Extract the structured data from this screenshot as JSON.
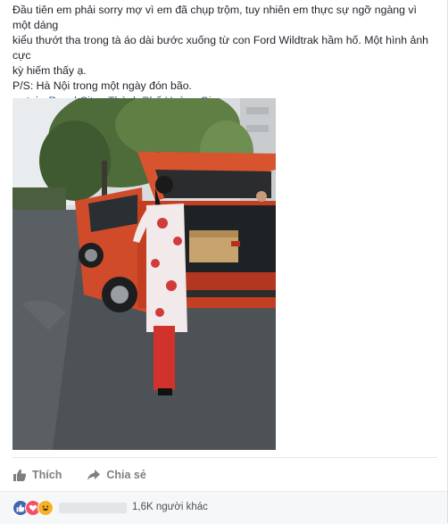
{
  "post": {
    "text_lines": [
      "Đầu tiên em phải sorry mợ vì em đã chụp trộm, tuy nhiên em thực sự ngỡ ngàng vì một dáng",
      "kiểu thướt tha trong tà áo dài bước xuống từ con Ford Wildtrak hầm hố. Một hình ảnh cực",
      "kỳ hiếm thấy ạ.",
      "P/S: Hà Nội trong một ngày đón bão."
    ],
    "location_prefix": "— tại",
    "location_name": "Royal City - Thành Phố Hoàng Gia."
  },
  "photo": {
    "icon": "photo-woman-ao-dai-orange-pickup-truck"
  },
  "actions": {
    "like_label": "Thích",
    "share_label": "Chia sẻ",
    "like_icon": "thumbs-up-icon",
    "share_icon": "share-arrow-icon"
  },
  "reactions": {
    "types": [
      "like",
      "love",
      "haha"
    ],
    "count_text": "1,6K người khác",
    "colors": {
      "like": "#4267b2",
      "love": "#f25268",
      "haha": "#f7b125"
    }
  }
}
